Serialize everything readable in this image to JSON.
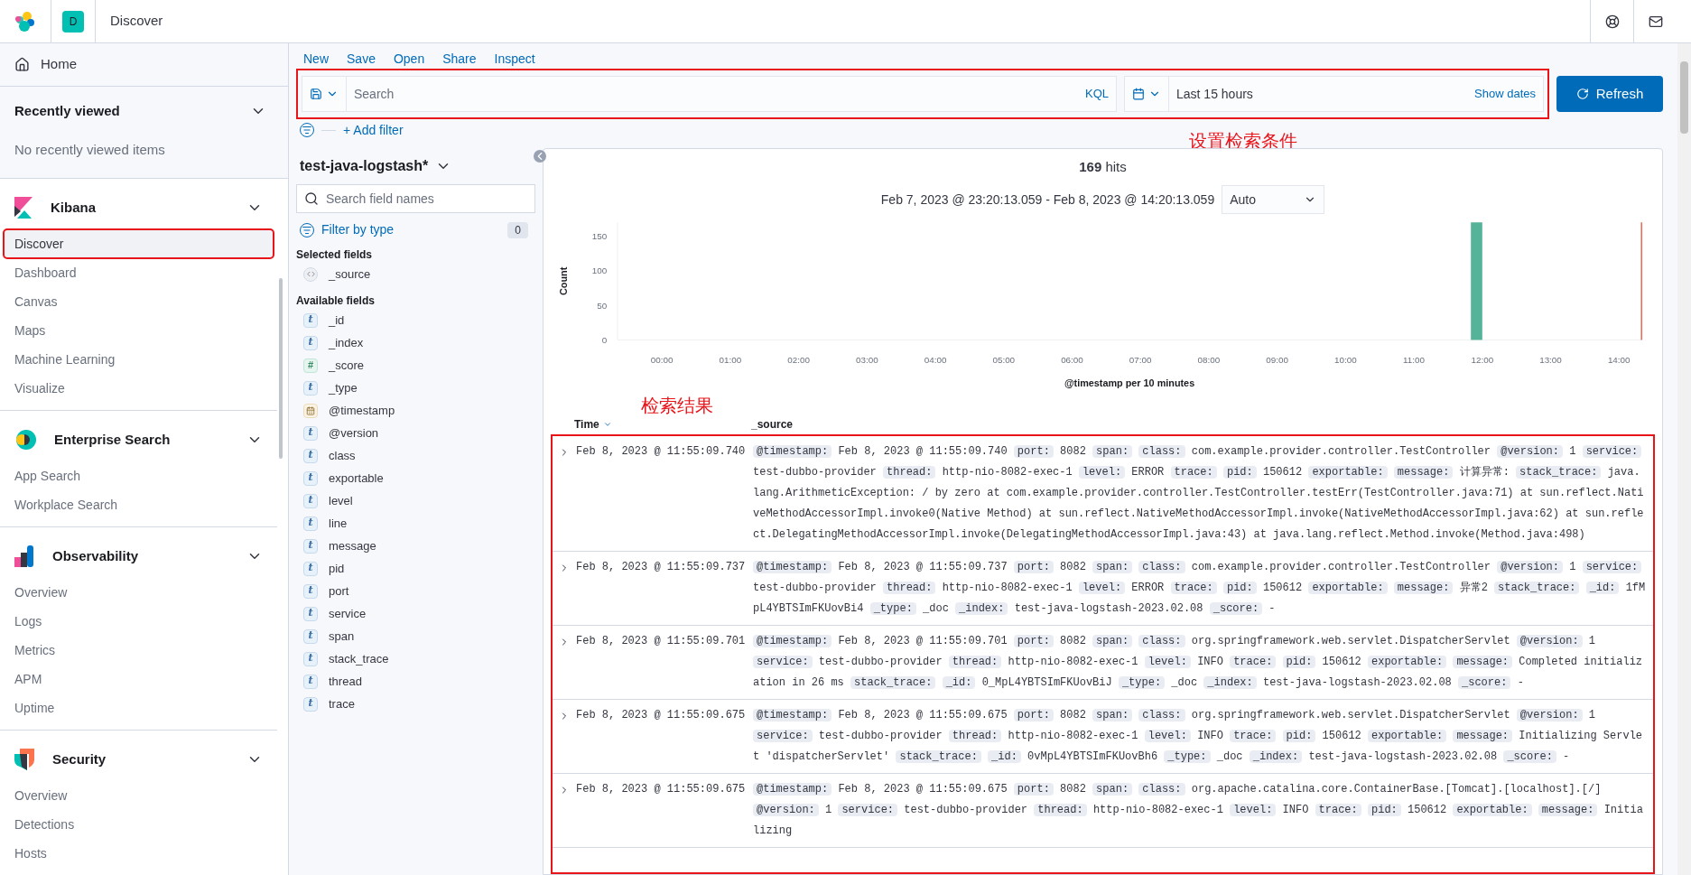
{
  "header": {
    "space_initial": "D",
    "title": "Discover"
  },
  "sidebar": {
    "home": "Home",
    "recent": {
      "title": "Recently viewed",
      "expanded": true,
      "empty": "No recently viewed items"
    },
    "groups": [
      {
        "kind": "kibana",
        "title": "Kibana",
        "expanded": true,
        "items": [
          {
            "label": "Discover",
            "selected": true
          },
          {
            "label": "Dashboard",
            "selected": false
          },
          {
            "label": "Canvas",
            "selected": false
          },
          {
            "label": "Maps",
            "selected": false
          },
          {
            "label": "Machine Learning",
            "selected": false
          },
          {
            "label": "Visualize",
            "selected": false
          }
        ]
      },
      {
        "kind": "enterprise",
        "title": "Enterprise Search",
        "expanded": true,
        "items": [
          {
            "label": "App Search",
            "selected": false
          },
          {
            "label": "Workplace Search",
            "selected": false
          }
        ]
      },
      {
        "kind": "observability",
        "title": "Observability",
        "expanded": true,
        "items": [
          {
            "label": "Overview",
            "selected": false
          },
          {
            "label": "Logs",
            "selected": false
          },
          {
            "label": "Metrics",
            "selected": false
          },
          {
            "label": "APM",
            "selected": false
          },
          {
            "label": "Uptime",
            "selected": false
          }
        ]
      },
      {
        "kind": "security",
        "title": "Security",
        "expanded": true,
        "items": [
          {
            "label": "Overview",
            "selected": false
          },
          {
            "label": "Detections",
            "selected": false
          },
          {
            "label": "Hosts",
            "selected": false
          }
        ]
      }
    ]
  },
  "top_menu": [
    "New",
    "Save",
    "Open",
    "Share",
    "Inspect"
  ],
  "query": {
    "placeholder": "Search",
    "language": "KQL",
    "time_range": "Last 15 hours",
    "show_dates": "Show dates",
    "refresh": "Refresh"
  },
  "add_filter": "+ Add filter",
  "annotations": [
    "设置检索条件",
    "检索结果"
  ],
  "index_pattern": "test-java-logstash*",
  "field_search": {
    "placeholder": "Search field names"
  },
  "filter_by_type": {
    "label": "Filter by type",
    "count": "0"
  },
  "selected_fields": {
    "title": "Selected fields",
    "fields": [
      {
        "kind": "source",
        "name": "_source"
      }
    ]
  },
  "available_fields": {
    "title": "Available fields",
    "fields": [
      {
        "kind": "string",
        "type_mark": "t",
        "name": "_id"
      },
      {
        "kind": "string",
        "type_mark": "t",
        "name": "_index"
      },
      {
        "kind": "number",
        "type_mark": "#",
        "name": "_score"
      },
      {
        "kind": "string",
        "type_mark": "t",
        "name": "_type"
      },
      {
        "kind": "date",
        "name": "@timestamp"
      },
      {
        "kind": "string",
        "type_mark": "t",
        "name": "@version"
      },
      {
        "kind": "string",
        "type_mark": "t",
        "name": "class"
      },
      {
        "kind": "string",
        "type_mark": "t",
        "name": "exportable"
      },
      {
        "kind": "string",
        "type_mark": "t",
        "name": "level"
      },
      {
        "kind": "string",
        "type_mark": "t",
        "name": "line"
      },
      {
        "kind": "string",
        "type_mark": "t",
        "name": "message"
      },
      {
        "kind": "string",
        "type_mark": "t",
        "name": "pid"
      },
      {
        "kind": "string",
        "type_mark": "t",
        "name": "port"
      },
      {
        "kind": "string",
        "type_mark": "t",
        "name": "service"
      },
      {
        "kind": "string",
        "type_mark": "t",
        "name": "span"
      },
      {
        "kind": "string",
        "type_mark": "t",
        "name": "stack_trace"
      },
      {
        "kind": "string",
        "type_mark": "t",
        "name": "thread"
      },
      {
        "kind": "string",
        "type_mark": "t",
        "name": "trace"
      }
    ]
  },
  "hits": {
    "count": "169",
    "label": "hits"
  },
  "date_range": "Feb 7, 2023 @ 23:20:13.059 - Feb 8, 2023 @ 14:20:13.059",
  "interval": "Auto",
  "chart_data": {
    "type": "bar",
    "xlabel": "@timestamp per 10 minutes",
    "ylabel": "Count",
    "x": [
      11.917
    ],
    "values": [
      169
    ],
    "xlim": [
      -0.65,
      14.33
    ],
    "ylim": [
      0,
      169
    ],
    "xticks": [
      {
        "value": 0,
        "label": "00:00"
      },
      {
        "value": 1,
        "label": "01:00"
      },
      {
        "value": 2,
        "label": "02:00"
      },
      {
        "value": 3,
        "label": "03:00"
      },
      {
        "value": 4,
        "label": "04:00"
      },
      {
        "value": 5,
        "label": "05:00"
      },
      {
        "value": 6,
        "label": "06:00"
      },
      {
        "value": 7,
        "label": "07:00"
      },
      {
        "value": 8,
        "label": "08:00"
      },
      {
        "value": 9,
        "label": "09:00"
      },
      {
        "value": 10,
        "label": "10:00"
      },
      {
        "value": 11,
        "label": "11:00"
      },
      {
        "value": 12,
        "label": "12:00"
      },
      {
        "value": 13,
        "label": "13:00"
      },
      {
        "value": 14,
        "label": "14:00"
      }
    ],
    "yticks": [
      0,
      50,
      100,
      150
    ]
  },
  "table": {
    "columns": [
      {
        "label": "Time",
        "sorted": true
      },
      {
        "label": "_source"
      }
    ],
    "rows": [
      {
        "expanded": false,
        "time": "Feb 8, 2023 @ 11:55:09.740",
        "source": [
          {
            "key": "@timestamp:",
            "value": "Feb 8, 2023 @ 11:55:09.740"
          },
          {
            "key": "port:",
            "value": "8082"
          },
          {
            "key": "span:"
          },
          {
            "key": "class:",
            "value": "com.example.provider.controller.TestController"
          },
          {
            "key": "@version:",
            "value": "1"
          },
          {
            "key": "service:",
            "value": "test-dubbo-provider"
          },
          {
            "key": "thread:",
            "value": "http-nio-8082-exec-1"
          },
          {
            "key": "level:",
            "value": "ERROR"
          },
          {
            "key": "trace:"
          },
          {
            "key": "pid:",
            "value": "150612"
          },
          {
            "key": "exportable:"
          },
          {
            "key": "message:",
            "value": "计算异常:"
          },
          {
            "key": "stack_trace:",
            "value": "java.lang.ArithmeticException: / by zero at com.example.provider.controller.TestController.testErr(TestController.java:71) at sun.reflect.NativeMethodAccessorImpl.invoke0(Native Method) at sun.reflect.NativeMethodAccessorImpl.invoke(NativeMethodAccessorImpl.java:62) at sun.reflect.DelegatingMethodAccessorImpl.invoke(DelegatingMethodAccessorImpl.java:43) at java.lang.reflect.Method.invoke(Method.java:498)"
          }
        ]
      },
      {
        "expanded": false,
        "time": "Feb 8, 2023 @ 11:55:09.737",
        "source": [
          {
            "key": "@timestamp:",
            "value": "Feb 8, 2023 @ 11:55:09.737"
          },
          {
            "key": "port:",
            "value": "8082"
          },
          {
            "key": "span:"
          },
          {
            "key": "class:",
            "value": "com.example.provider.controller.TestController"
          },
          {
            "key": "@version:",
            "value": "1"
          },
          {
            "key": "service:",
            "value": "test-dubbo-provider"
          },
          {
            "key": "thread:",
            "value": "http-nio-8082-exec-1"
          },
          {
            "key": "level:",
            "value": "ERROR"
          },
          {
            "key": "trace:"
          },
          {
            "key": "pid:",
            "value": "150612"
          },
          {
            "key": "exportable:"
          },
          {
            "key": "message:",
            "value": "异常2"
          },
          {
            "key": "stack_trace:"
          },
          {
            "key": "_id:",
            "value": "1fMpL4YBTSImFKUovBi4"
          },
          {
            "key": "_type:",
            "value": "_doc"
          },
          {
            "key": "_index:",
            "value": "test-java-logstash-2023.02.08"
          },
          {
            "key": "_score:",
            "value": "-"
          }
        ]
      },
      {
        "expanded": false,
        "time": "Feb 8, 2023 @ 11:55:09.701",
        "source": [
          {
            "key": "@timestamp:",
            "value": "Feb 8, 2023 @ 11:55:09.701"
          },
          {
            "key": "port:",
            "value": "8082"
          },
          {
            "key": "span:"
          },
          {
            "key": "class:",
            "value": "org.springframework.web.servlet.DispatcherServlet"
          },
          {
            "key": "@version:",
            "value": "1"
          },
          {
            "key": "service:",
            "value": "test-dubbo-provider"
          },
          {
            "key": "thread:",
            "value": "http-nio-8082-exec-1"
          },
          {
            "key": "level:",
            "value": "INFO"
          },
          {
            "key": "trace:"
          },
          {
            "key": "pid:",
            "value": "150612"
          },
          {
            "key": "exportable:"
          },
          {
            "key": "message:",
            "value": "Completed initialization in 26 ms"
          },
          {
            "key": "stack_trace:"
          },
          {
            "key": "_id:",
            "value": "0_MpL4YBTSImFKUovBiJ"
          },
          {
            "key": "_type:",
            "value": "_doc"
          },
          {
            "key": "_index:",
            "value": "test-java-logstash-2023.02.08"
          },
          {
            "key": "_score:",
            "value": "-"
          }
        ]
      },
      {
        "expanded": false,
        "time": "Feb 8, 2023 @ 11:55:09.675",
        "source": [
          {
            "key": "@timestamp:",
            "value": "Feb 8, 2023 @ 11:55:09.675"
          },
          {
            "key": "port:",
            "value": "8082"
          },
          {
            "key": "span:"
          },
          {
            "key": "class:",
            "value": "org.springframework.web.servlet.DispatcherServlet"
          },
          {
            "key": "@version:",
            "value": "1"
          },
          {
            "key": "service:",
            "value": "test-dubbo-provider"
          },
          {
            "key": "thread:",
            "value": "http-nio-8082-exec-1"
          },
          {
            "key": "level:",
            "value": "INFO"
          },
          {
            "key": "trace:"
          },
          {
            "key": "pid:",
            "value": "150612"
          },
          {
            "key": "exportable:"
          },
          {
            "key": "message:",
            "value": "Initializing Servlet 'dispatcherServlet'"
          },
          {
            "key": "stack_trace:"
          },
          {
            "key": "_id:",
            "value": "0vMpL4YBTSImFKUovBh6"
          },
          {
            "key": "_type:",
            "value": "_doc"
          },
          {
            "key": "_index:",
            "value": "test-java-logstash-2023.02.08"
          },
          {
            "key": "_score:",
            "value": "-"
          }
        ]
      },
      {
        "expanded": false,
        "time": "Feb 8, 2023 @ 11:55:09.675",
        "source": [
          {
            "key": "@timestamp:",
            "value": "Feb 8, 2023 @ 11:55:09.675"
          },
          {
            "key": "port:",
            "value": "8082"
          },
          {
            "key": "span:"
          },
          {
            "key": "class:",
            "value": "org.apache.catalina.core.ContainerBase.[Tomcat].[localhost].[/]"
          },
          {
            "key": "@version:",
            "value": "1"
          },
          {
            "key": "service:",
            "value": "test-dubbo-provider"
          },
          {
            "key": "thread:",
            "value": "http-nio-8082-exec-1"
          },
          {
            "key": "level:",
            "value": "INFO"
          },
          {
            "key": "trace:"
          },
          {
            "key": "pid:",
            "value": "150612"
          },
          {
            "key": "exportable:"
          },
          {
            "key": "message:",
            "value": "Initializing"
          }
        ]
      }
    ]
  }
}
